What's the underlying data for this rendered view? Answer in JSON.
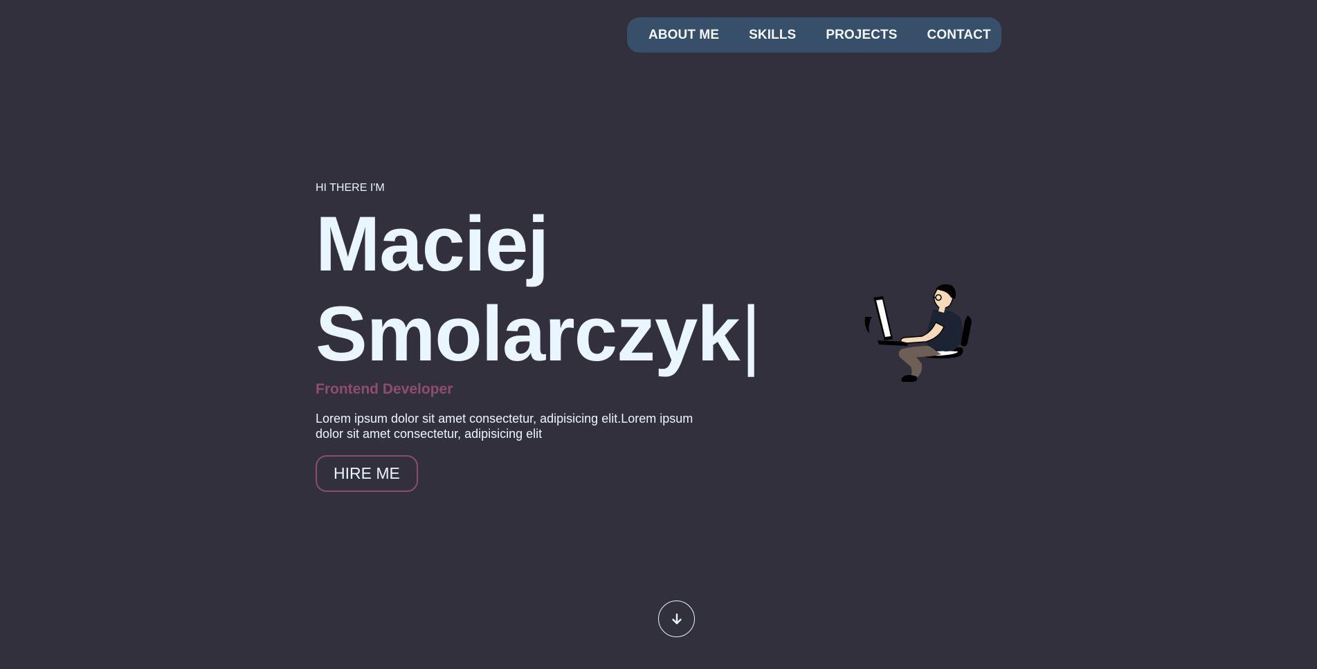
{
  "nav": {
    "items": [
      {
        "label": "ABOUT ME"
      },
      {
        "label": "SKILLS"
      },
      {
        "label": "PROJECTS"
      },
      {
        "label": "CONTACT"
      }
    ]
  },
  "hero": {
    "greeting": "HI THERE I'M",
    "first_name": "Maciej",
    "last_name": "Smolarczyk",
    "caret": "|",
    "role": "Frontend Developer",
    "description": "Lorem ipsum dolor sit amet consectetur, adipisicing elit.Lorem ipsum dolor sit amet consectetur, adipisicing elit",
    "cta_label": "HIRE ME"
  },
  "icons": {
    "illustration": "developer-at-computer-illustration",
    "scroll": "arrow-down-icon"
  },
  "colors": {
    "background": "#32303d",
    "nav_background": "#384f69",
    "text": "#eaf6ff",
    "accent": "#8e4d6e"
  }
}
